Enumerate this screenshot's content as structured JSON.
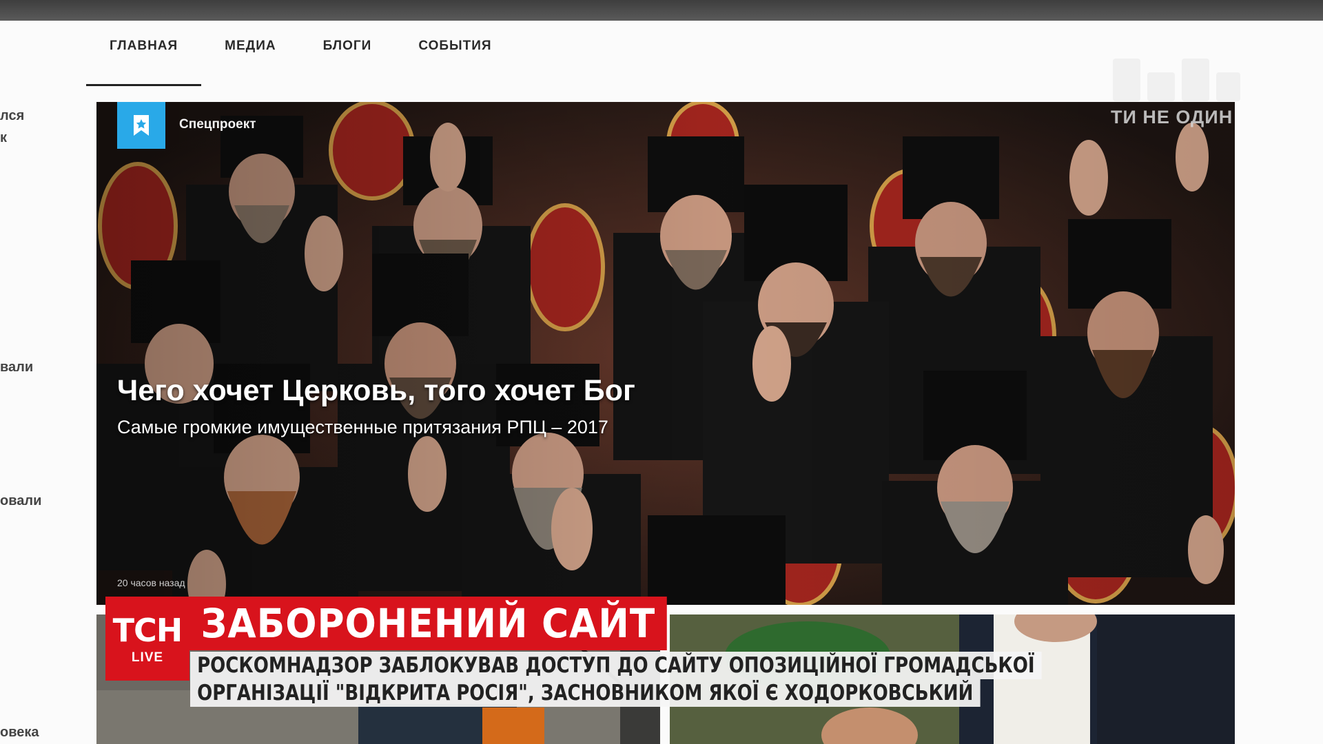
{
  "nav": {
    "items": [
      "ГЛАВНАЯ",
      "МЕДИА",
      "БЛОГИ",
      "СОБЫТИЯ"
    ],
    "active": "ГЛАВНАЯ"
  },
  "sidebar_snippets": [
    "лся",
    "к",
    "вали",
    "овали",
    "овека"
  ],
  "logo": {
    "tagline": "ТИ НЕ ОДИН"
  },
  "hero": {
    "badge_icon": "star-bookmark-icon",
    "badge_label": "Спецпроект",
    "title": "Чего хочет Церковь, того хочет Бог",
    "subtitle": "Самые громкие имущественные притязания РПЦ – 2017",
    "time": "20 часов назад"
  },
  "tsn": {
    "logo_text": "ТСН",
    "live": "LIVE",
    "headline": "ЗАБОРОНЕНИЙ САЙТ",
    "line1": "РОСКОМНАДЗОР ЗАБЛОКУВАВ ДОСТУП ДО САЙТУ ОПОЗИЦІЙНОЇ ГРОМАДСЬКОЇ",
    "line2": "ОРГАНІЗАЦІЇ \"ВІДКРИТА РОСІЯ\", ЗАСНОВНИКОМ ЯКОЇ Є ХОДОРКОВСЬКИЙ"
  },
  "colors": {
    "accent_blue": "#29a9e8",
    "tsn_red": "#d8131c"
  }
}
